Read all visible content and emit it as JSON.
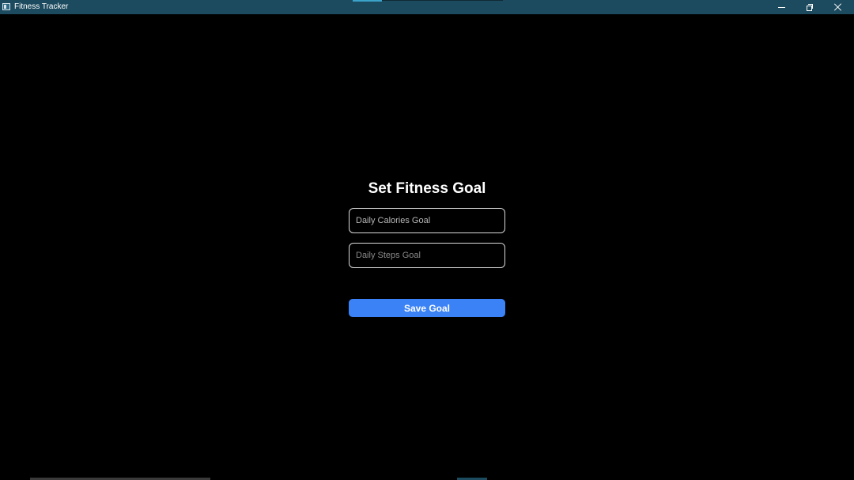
{
  "window": {
    "title": "Fitness Tracker"
  },
  "titlebar": {
    "icons": [
      "app-icon",
      "minimize-icon",
      "restore-icon",
      "close-icon"
    ]
  },
  "form": {
    "title": "Set Fitness Goal",
    "calories": {
      "placeholder": "Daily Calories Goal",
      "value": ""
    },
    "steps": {
      "placeholder": "Daily Steps Goal",
      "value": ""
    },
    "save_label": "Save Goal"
  },
  "colors": {
    "background": "#000000",
    "titlebar": "#1c4a5e",
    "accent": "#3b82f6",
    "input_border": "#d9d9d9"
  }
}
